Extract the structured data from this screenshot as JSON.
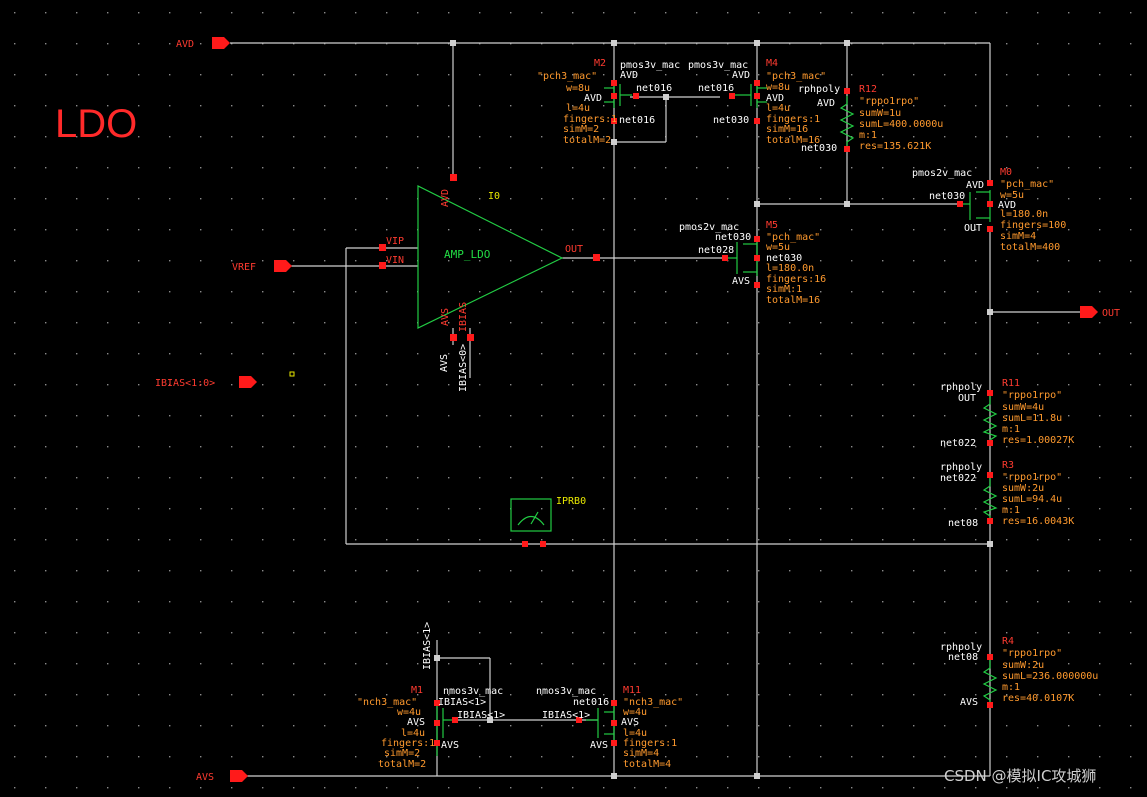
{
  "title": "LDO",
  "watermark": "CSDN @模拟IC攻城狮",
  "pins": {
    "avd": "AVD",
    "avs": "AVS",
    "vref": "VREF",
    "ibias": "IBIAS<1:0>",
    "out": "OUT"
  },
  "amp": {
    "instance": "I0",
    "cell": "AMP_LDO",
    "vip": "VIP",
    "vin": "VIN",
    "out": "OUT",
    "avd": "AVD",
    "avs": "AVS",
    "ibias": "IBIAS",
    "net_avs": "AVS",
    "net_ibias": "IBIAS<0>"
  },
  "probe": {
    "name": "IPRB0"
  },
  "devices": {
    "m2": {
      "name": "M2",
      "cell": "pmos3v_mac",
      "model": "\"pch3_mac\"",
      "p1": "w=8u",
      "p2": "l=4u",
      "p3": "fingers:1",
      "p4": "simM=2",
      "p5": "totalM=2",
      "n_s": "AVD",
      "n_b": "AVD",
      "n_g": "net016",
      "n_d": "net016"
    },
    "m4": {
      "name": "M4",
      "cell": "pmos3v_mac",
      "model": "\"pch3_mac\"",
      "p1": "w=8u",
      "p2": "l=4u",
      "p3": "fingers:1",
      "p4": "simM=16",
      "p5": "totalM=16",
      "n_s": "AVD",
      "n_b": "AVD",
      "n_g": "net016",
      "n_d": "net030"
    },
    "m5": {
      "name": "M5",
      "cell": "pmos2v_mac",
      "model": "\"pch_mac\"",
      "p1": "w=5u",
      "p2": "l=180.0n",
      "p3": "fingers:16",
      "p4": "simM:1",
      "p5": "totalM=16",
      "n_s": "net030",
      "n_b": "net030",
      "n_g": "net028",
      "n_d": "AVS"
    },
    "m0": {
      "name": "M0",
      "cell": "pmos2v_mac",
      "model": "\"pch_mac\"",
      "p1": "w=5u",
      "p2": "l=180.0n",
      "p3": "fingers=100",
      "p4": "simM=4",
      "p5": "totalM=400",
      "n_s": "AVD",
      "n_b": "AVD",
      "n_g": "net030",
      "n_d": "OUT"
    },
    "m1": {
      "name": "M1",
      "cell": "nmos3v_mac",
      "model": "\"nch3_mac\"",
      "p1": "w=4u",
      "p2": "l=4u",
      "p3": "fingers:1",
      "p4": "simM=2",
      "p5": "totalM=2",
      "n_g": "IBIAS<1>",
      "n_g2": "IBIAS<1>",
      "n_s": "AVS",
      "n_b": "AVS",
      "n_top": "IBIAS<1>"
    },
    "m11": {
      "name": "M11",
      "cell": "nmos3v_mac",
      "model": "\"nch3_mac\"",
      "p1": "w=4u",
      "p2": "l=4u",
      "p3": "fingers:1",
      "p4": "simM=4",
      "p5": "totalM=4",
      "n_d": "net016",
      "n_g": "IBIAS<1>",
      "n_s": "AVS",
      "n_b": "AVS"
    }
  },
  "resistors": {
    "r12": {
      "name": "R12",
      "cell": "rphpoly",
      "model": "\"rppo1rpo\"",
      "p1": "sumW=1u",
      "p2": "sumL=400.0000u",
      "p3": "m:1",
      "p4": "res=135.621K",
      "n_top": "AVD",
      "n_bot": "net030"
    },
    "r11": {
      "name": "R11",
      "cell": "rphpoly",
      "model": "\"rppo1rpo\"",
      "p1": "sumW=4u",
      "p2": "sumL=11.8u",
      "p3": "m:1",
      "p4": "res=1.00027K",
      "n_top": "OUT",
      "n_bot": "net022"
    },
    "r3": {
      "name": "R3",
      "cell": "rphpoly",
      "model": "\"rppo1rpo\"",
      "p1": "sumW:2u",
      "p2": "sumL=94.4u",
      "p3": "m:1",
      "p4": "res=16.0043K",
      "n_top": "net022",
      "n_bot": "net08"
    },
    "r4": {
      "name": "R4",
      "cell": "rphpoly",
      "model": "\"rppo1rpo\"",
      "p1": "sumW:2u",
      "p2": "sumL=236.000000u",
      "p3": "m:1",
      "p4": "res=40.0107K",
      "n_top": "net08",
      "n_bot": "AVS"
    }
  },
  "colors": {
    "background": "#000000",
    "wire": "#cfcfcf",
    "symbol": "#22cc44",
    "pin": "#ff1a1a",
    "label": "#ff9a2e",
    "title": "#ff2a2a"
  }
}
